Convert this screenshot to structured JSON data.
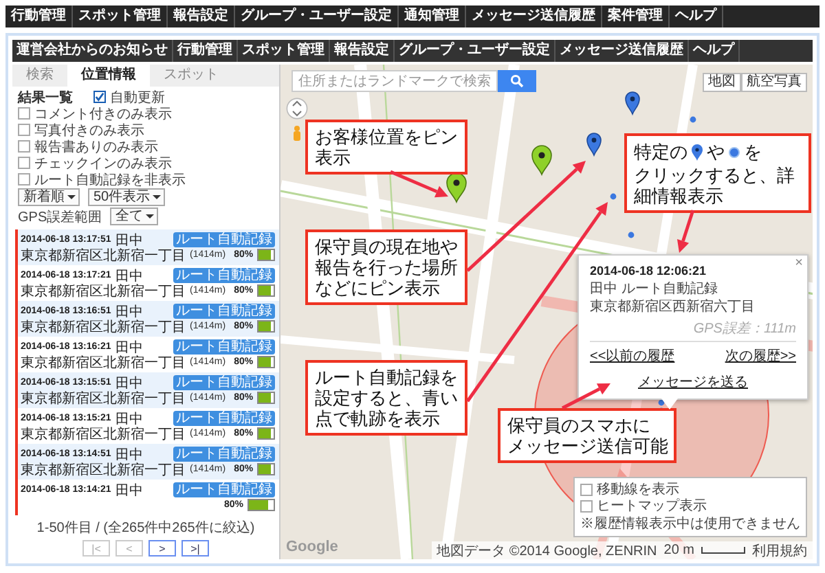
{
  "top_nav": [
    "行動管理",
    "スポット管理",
    "報告設定",
    "グループ・ユーザー設定",
    "通知管理",
    "メッセージ送信履歴",
    "案件管理",
    "ヘルプ"
  ],
  "inner_nav": [
    "運営会社からのお知らせ",
    "行動管理",
    "スポット管理",
    "報告設定",
    "グループ・ユーザー設定",
    "メッセージ送信履歴",
    "ヘルプ"
  ],
  "tabs": [
    {
      "label": "検索",
      "selected": false
    },
    {
      "label": "位置情報",
      "selected": true
    },
    {
      "label": "スポット",
      "selected": false
    }
  ],
  "filters": {
    "title": "結果一覧",
    "auto_update": {
      "label": "自動更新",
      "checked": true
    },
    "options": [
      {
        "label": "コメント付きのみ表示",
        "checked": false
      },
      {
        "label": "写真付きのみ表示",
        "checked": false
      },
      {
        "label": "報告書ありのみ表示",
        "checked": false
      },
      {
        "label": "チェックインのみ表示",
        "checked": false
      },
      {
        "label": "ルート自動記録を非表示",
        "checked": false
      }
    ],
    "sort": "新着順",
    "per_page": "50件表示",
    "gps_label": "GPS誤差範囲",
    "gps_value": "全て"
  },
  "results": [
    {
      "time": "2014-06-18 13:17:51",
      "badge": "ルート自動記録",
      "name": "田中",
      "battery": "80%",
      "level": 0.8,
      "address": "東京都新宿区北新宿一丁目",
      "distance": "(1414m)"
    },
    {
      "time": "2014-06-18 13:17:21",
      "badge": "ルート自動記録",
      "name": "田中",
      "battery": "80%",
      "level": 0.8,
      "address": "東京都新宿区北新宿一丁目",
      "distance": "(1414m)"
    },
    {
      "time": "2014-06-18 13:16:51",
      "badge": "ルート自動記録",
      "name": "田中",
      "battery": "80%",
      "level": 0.8,
      "address": "東京都新宿区北新宿一丁目",
      "distance": "(1414m)"
    },
    {
      "time": "2014-06-18 13:16:21",
      "badge": "ルート自動記録",
      "name": "田中",
      "battery": "80%",
      "level": 0.8,
      "address": "東京都新宿区北新宿一丁目",
      "distance": "(1414m)"
    },
    {
      "time": "2014-06-18 13:15:51",
      "badge": "ルート自動記録",
      "name": "田中",
      "battery": "80%",
      "level": 0.8,
      "address": "東京都新宿区北新宿一丁目",
      "distance": "(1414m)"
    },
    {
      "time": "2014-06-18 13:15:21",
      "badge": "ルート自動記録",
      "name": "田中",
      "battery": "80%",
      "level": 0.8,
      "address": "東京都新宿区北新宿一丁目",
      "distance": "(1414m)"
    },
    {
      "time": "2014-06-18 13:14:51",
      "badge": "ルート自動記録",
      "name": "田中",
      "battery": "80%",
      "level": 0.8,
      "address": "東京都新宿区北新宿一丁目",
      "distance": "(1414m)"
    },
    {
      "time": "2014-06-18 13:14:21",
      "badge": "ルート自動記録",
      "name": "田中",
      "battery": "80%",
      "level": 0.8
    }
  ],
  "pager": {
    "summary": "1-50件目 / (全265件中265件に絞込)",
    "buttons": [
      {
        "label": "|<",
        "disabled": true
      },
      {
        "label": "<",
        "disabled": true
      },
      {
        "label": ">",
        "disabled": false
      },
      {
        "label": ">|",
        "disabled": false
      }
    ]
  },
  "map": {
    "search": {
      "placeholder": "住所またはランドマークで検索"
    },
    "map_types": [
      "地図",
      "航空写真"
    ],
    "popup": {
      "time": "2014-06-18 12:06:21",
      "title": "田中 ルート自動記録",
      "address": "東京都新宿区西新宿六丁目",
      "gps": "GPS誤差：111m",
      "prev": "<<以前の履歴",
      "next": "次の履歴>>",
      "send": "メッセージを送る",
      "close": "×"
    },
    "layers": [
      {
        "label": "移動線を表示",
        "checked": false
      },
      {
        "label": "ヒートマップ表示",
        "checked": false
      }
    ],
    "layer_note": "※履歴情報表示中は使用できません",
    "logo": "Google",
    "attribution": "地図データ ©2014 Google, ZENRIN",
    "scale": "20 m",
    "terms": "利用規約"
  },
  "callouts": [
    {
      "kind": "text",
      "lines": [
        "お客様位置をピン",
        "表示"
      ]
    },
    {
      "kind": "text",
      "lines": [
        "保守員の現在地や",
        "報告を行った場所",
        "などにピン表示"
      ]
    },
    {
      "kind": "text",
      "lines": [
        "ルート自動記録を",
        "設定すると、青い",
        "点で軌跡を表示"
      ]
    },
    {
      "kind": "text",
      "lines": [
        "保守員のスマホに",
        "メッセージ送信可能"
      ]
    },
    {
      "kind": "icons",
      "parts": [
        "特定の",
        "や",
        "を"
      ],
      "lines": [
        "クリックすると、詳",
        "細情報表示"
      ]
    }
  ]
}
